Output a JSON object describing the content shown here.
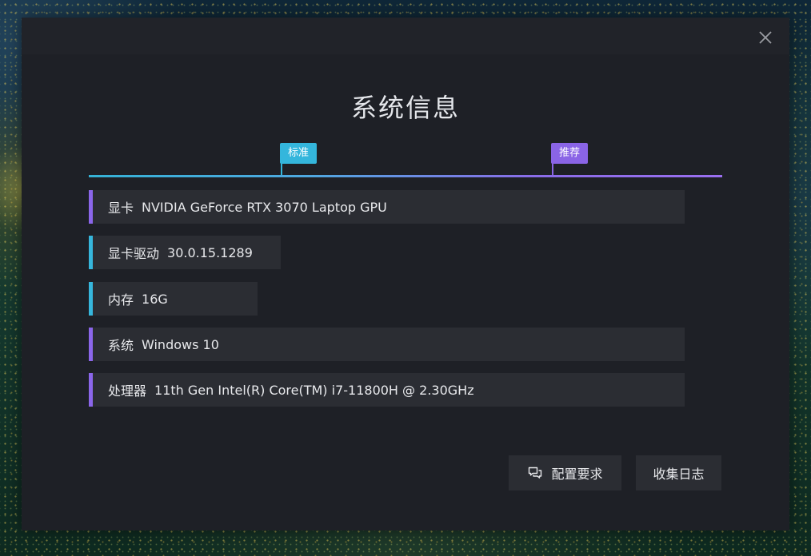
{
  "dialog": {
    "title": "系统信息"
  },
  "tiers": {
    "standard": "标准",
    "recommended": "推荐"
  },
  "specs": [
    {
      "label": "显卡",
      "value": "NVIDIA GeForce RTX 3070 Laptop GPU",
      "accent": "purple"
    },
    {
      "label": "显卡驱动",
      "value": "30.0.15.1289",
      "accent": "cyan"
    },
    {
      "label": "内存",
      "value": "16G",
      "accent": "cyan"
    },
    {
      "label": "系统",
      "value": "Windows 10",
      "accent": "purple"
    },
    {
      "label": "处理器",
      "value": "11th Gen Intel(R) Core(TM) i7-11800H @ 2.30GHz",
      "accent": "purple"
    }
  ],
  "buttons": {
    "config_requirements": "配置要求",
    "collect_logs": "收集日志"
  },
  "icons": {
    "close": "close-icon",
    "chat": "chat-bubbles-icon"
  },
  "colors": {
    "standard": "#34b6dc",
    "recommended": "#8a64e6",
    "dialog_bg": "#1e2026",
    "row_bg": "#2b2d33"
  }
}
